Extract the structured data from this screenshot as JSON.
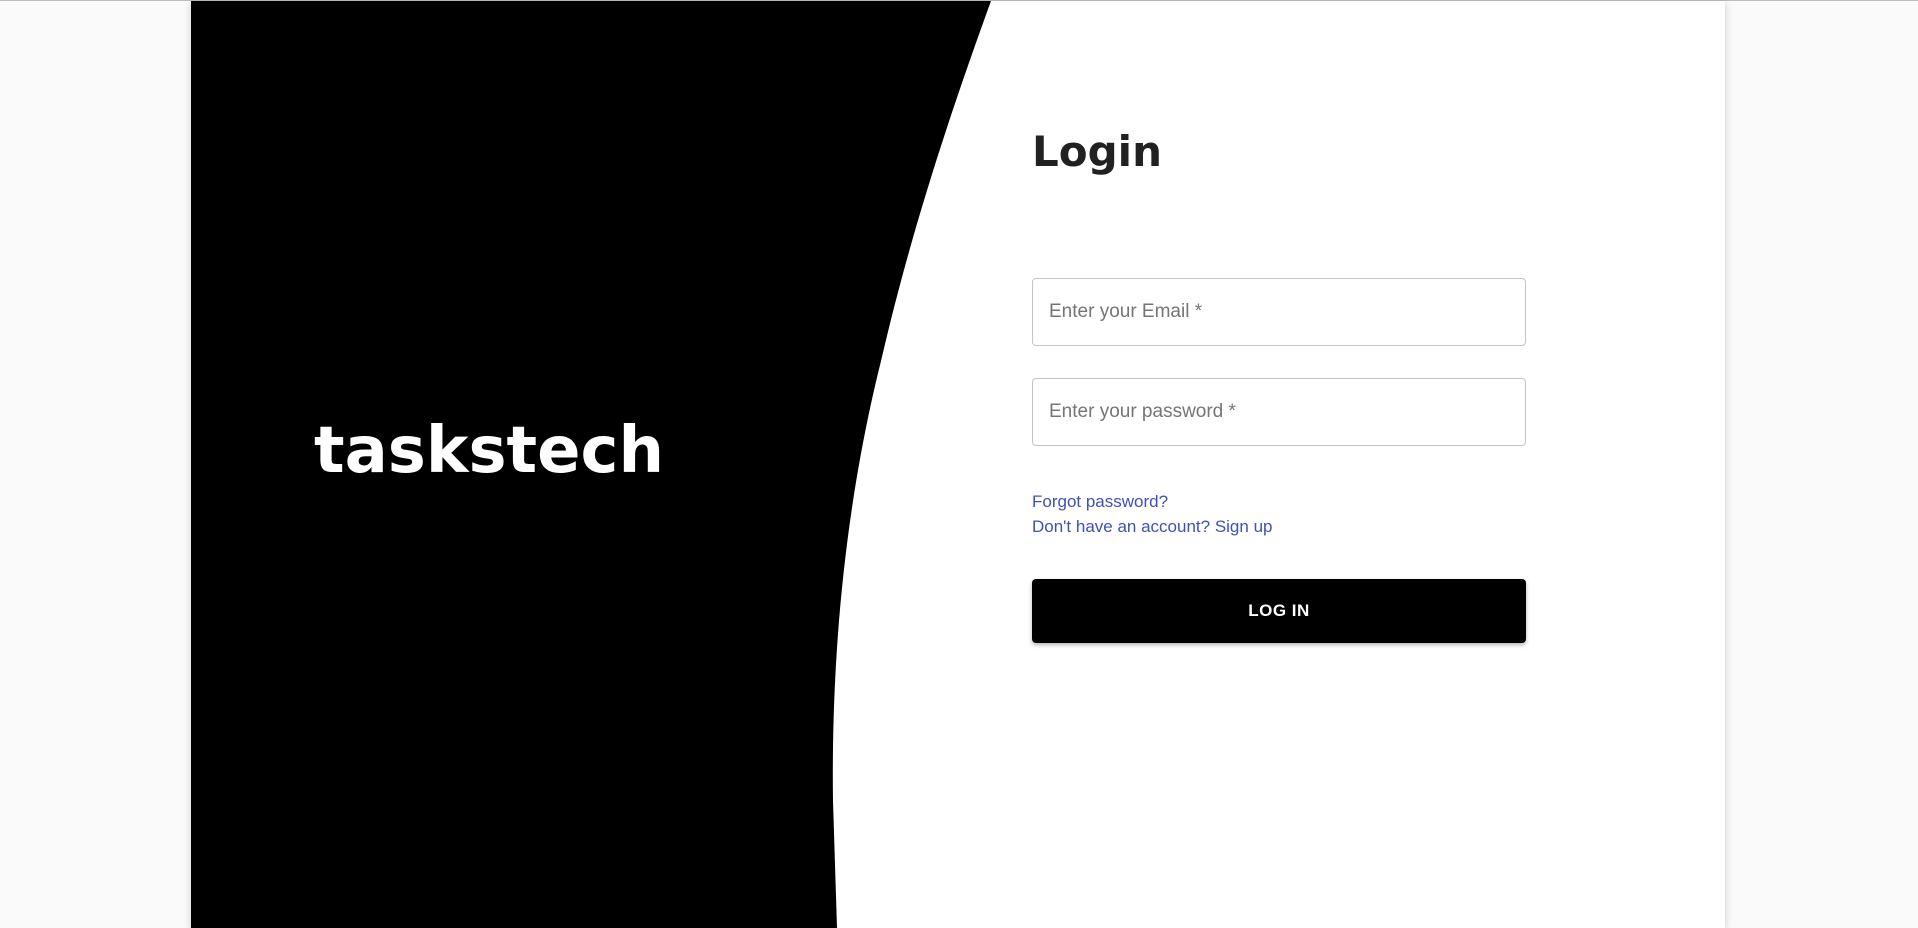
{
  "brand": {
    "logo_text": "taskstech",
    "panel_color": "#000000"
  },
  "login": {
    "title": "Login",
    "email": {
      "value": "",
      "placeholder": "Enter your Email *"
    },
    "password": {
      "value": "",
      "placeholder": "Enter your password *"
    },
    "forgot_password_link": "Forgot password?",
    "signup_link": "Don't have an account? Sign up",
    "login_button": "LOG IN",
    "link_color": "#3f51b5",
    "button_color": "#000000"
  }
}
